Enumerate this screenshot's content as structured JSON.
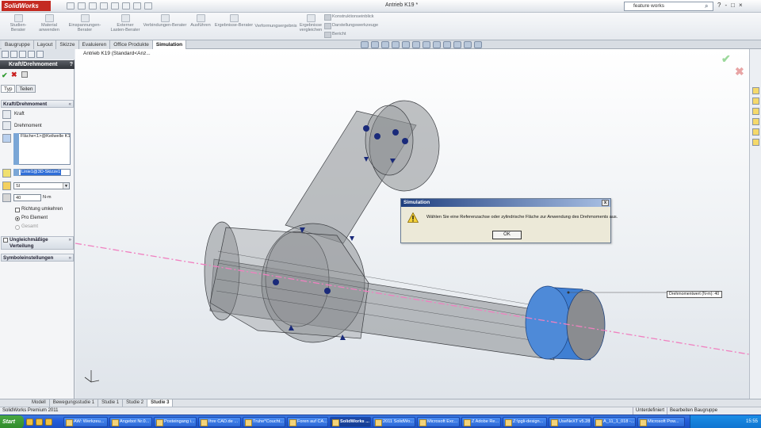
{
  "app": {
    "logo": "SolidWorks",
    "document_title": "Antrieb K19 *"
  },
  "search": {
    "value": "feature works"
  },
  "window_buttons": [
    "?",
    "-",
    "□",
    "×"
  ],
  "ribbon": {
    "buttons": [
      "Studien-Berater",
      "Material anwenden",
      "Einspannungen-Berater",
      "Externer Lasten-Berater",
      "Verbindungen-Berater",
      "Ausführen",
      "Ergebnisse-Berater",
      "Verformungsergebnis",
      "Ergebnisse vergleichen"
    ],
    "small_buttons": [
      "Konstruktionseinblick",
      "Darstellungswerkzeuge",
      "Bericht"
    ]
  },
  "command_tabs": [
    "Baugruppe",
    "Layout",
    "Skizze",
    "Evaluieren",
    "Office Produkte",
    "Simulation"
  ],
  "active_command_tab": "Simulation",
  "tree_item": "Antrieb K19  (Standard<Anz...",
  "property_manager": {
    "title": "Kraft/Drehmoment",
    "help": "?",
    "tabs": [
      "Typ",
      "Teilen"
    ],
    "section_force": "Kraft/Drehmoment",
    "force_label": "Kraft",
    "torque_label": "Drehmoment",
    "face_selection": "Fläche<1>@Keilwelle K1!",
    "axis_selection": "Linie1@3D-Skizze1",
    "unit": "SI",
    "value": "40",
    "value_unit": "N-m",
    "reverse_label": "Richtung umkehren",
    "per_element_label": "Pro Element",
    "total_label": "Gesamt",
    "section_nonuniform": "Ungleichmäßige Verteilung",
    "section_symbols": "Symboleinstellungen"
  },
  "dialog": {
    "title": "Simulation",
    "close": "x",
    "message": "Wählen Sie eine Referenzachse oder zylindrische Fläche zur Anwendung des Drehmoments aus.",
    "ok": "OK"
  },
  "callout": "Drehmomentwert (N-m): 40",
  "bottom_tabs": [
    "Modell",
    "Bewegungsstudie 1",
    "Studie 1",
    "Studie 2",
    "Studie 3"
  ],
  "active_bottom_tab": "Studie 3",
  "status": {
    "left": "SolidWorks Premium 2011",
    "state": "Unterdefiniert",
    "mode": "Bearbeiten Baugruppe"
  },
  "taskbar": {
    "start": "Start",
    "items": [
      "AW: Werkzeu...",
      "Angebot Nr.0...",
      "Posteingang i...",
      "Ihre CAD.de ...",
      "Truhe*Coucht...",
      "Foren auf CA...",
      "SolidWorks ...",
      "2011 SolidWo...",
      "Microsoft Exc...",
      "Z Adobe Re...",
      "Z:\\pgli-design...",
      "UseNeXT v5.28",
      "A_11_1_018 -...",
      "Microsoft Pow..."
    ],
    "active": "SolidWorks ...",
    "clock": "15:55"
  },
  "colors": {
    "accent": "#245edb",
    "model_face": "#3f7fd3",
    "axis_line": "#f080c0",
    "title_bar_dark": "#30343a"
  }
}
